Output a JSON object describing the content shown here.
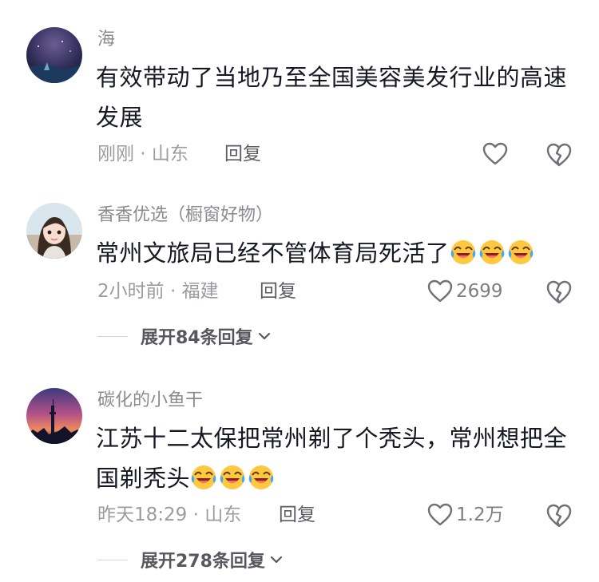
{
  "comments": [
    {
      "username": "海",
      "text": "有效带动了当地乃至全国美容美发行业的高速发展",
      "emoji_count": 0,
      "meta": "刚刚 · 山东",
      "reply_label": "回复",
      "like_count": ""
    },
    {
      "username": "香香优选（橱窗好物）",
      "text": "常州文旅局已经不管体育局死活了",
      "emoji_count": 3,
      "meta": "2小时前 · 福建",
      "reply_label": "回复",
      "like_count": "2699",
      "expand_label": "展开84条回复"
    },
    {
      "username": "碳化的小鱼干",
      "text": "江苏十二太保把常州剃了个秃头，常州想把全国剃秃头",
      "emoji_count": 3,
      "meta": "昨天18:29 · 山东",
      "reply_label": "回复",
      "like_count": "1.2万",
      "expand_label": "展开278条回复"
    }
  ],
  "icons": {
    "like": "heart-outline-icon",
    "dislike": "broken-heart-icon",
    "emoji": "laughing-crying-emoji-icon",
    "expand": "chevron-down-icon"
  }
}
